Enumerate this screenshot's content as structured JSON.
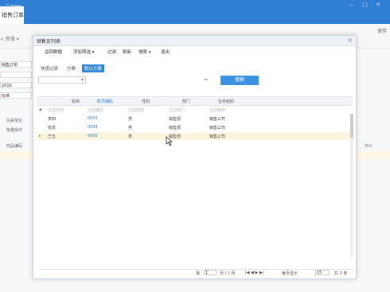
{
  "app": {
    "title": "云ERP",
    "tab_label": "销售订单",
    "window_controls": "— □ ✕",
    "save_label": "保存"
  },
  "background": {
    "toolbar_text": "< 新增 ▾",
    "fields": [
      "销售订单",
      "",
      "2016",
      "标准"
    ],
    "label_client": "往来单位",
    "label_batch": "批量操作",
    "row_label": "商品编码",
    "col_price": "单价"
  },
  "dialog": {
    "title": "销售员列表",
    "close_icon": "×",
    "menu": [
      "返回数据",
      "添加筛选 ▾",
      "过滤",
      "刷新",
      "搜索 ▾",
      "退出"
    ],
    "scheme_tabs": [
      {
        "label": "快速过滤",
        "active": false
      },
      {
        "label": "方案",
        "active": false
      },
      {
        "label": "默认方案",
        "active": true
      }
    ],
    "filter_placeholder": "",
    "operator": "=",
    "search_button": "搜索"
  },
  "table": {
    "columns": [
      "名称",
      "职员编码",
      "性别",
      "部门",
      "业务组织"
    ],
    "sorted_column": 1,
    "filter_row": [
      "过滤名称",
      "过滤编码",
      "过滤性别",
      "过滤部门",
      "过滤组织"
    ],
    "rows": [
      [
        "李四",
        "0003",
        "男",
        "销售部",
        "销售公司"
      ],
      [
        "张凯",
        "0004",
        "男",
        "销售部",
        "销售公司"
      ],
      [
        "王五",
        "0005",
        "男",
        "销售部",
        "销售公司"
      ]
    ],
    "selected_row": 2
  },
  "pager": {
    "page_label": "第",
    "page_value": "1",
    "page_of": "页 / 1 页",
    "nav_icons": "|◀ ◀ ▶ ▶|",
    "per_page_label": "每页显示",
    "per_page_value": "15",
    "total": "共 3 条"
  }
}
